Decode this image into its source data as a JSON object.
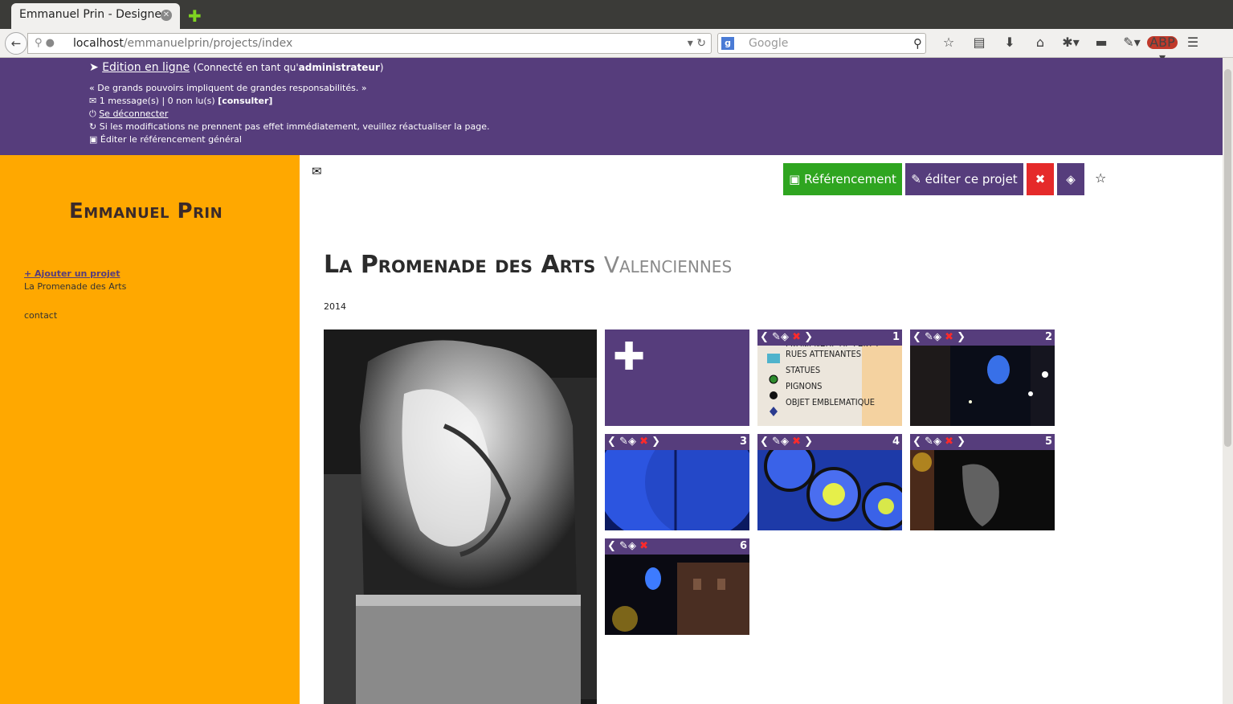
{
  "browser": {
    "tab_title": "Emmanuel Prin - Designer",
    "url_host": "localhost",
    "url_path": "/emmanuelprin/projects/index",
    "search_placeholder": "Google"
  },
  "admin": {
    "edition_label": "Edition en ligne",
    "connected_prefix": "(Connecté en tant qu'",
    "connected_user": "administrateur",
    "connected_suffix": ")",
    "quote": "« De grands pouvoirs impliquent de grandes responsabilités. »",
    "messages": "1 message(s) | 0 non lu(s)",
    "consult": "[consulter]",
    "logout": "Se déconnecter",
    "refresh_note": "Si les modifications ne prennent pas effet immédiatement, veuillez réactualiser la page.",
    "seo_general": "Éditer le référencement général"
  },
  "sidebar": {
    "brand": "Emmanuel Prin",
    "add_project": "+ Ajouter un projet",
    "project": "La Promenade des Arts",
    "contact": "contact"
  },
  "toolbar": {
    "referencement": "Référencement",
    "edit_project": "éditer ce projet"
  },
  "project": {
    "title": "La Promenade des Arts",
    "subtitle": "Valenciennes",
    "year": "2014"
  },
  "thumbs": [
    {
      "num": "1"
    },
    {
      "num": "2"
    },
    {
      "num": "3"
    },
    {
      "num": "4"
    },
    {
      "num": "5"
    },
    {
      "num": "6"
    }
  ],
  "map_legend": [
    "PROMENADE DES ARTS",
    "RUES ATTENANTES",
    "STATUES",
    "PIGNONS",
    "OBJET EMBLEMATIQUE"
  ],
  "colors": {
    "admin_bar": "#563d7c",
    "sidebar": "#ffa800",
    "seo_button": "#2fa520",
    "delete_button": "#e52a2a"
  }
}
